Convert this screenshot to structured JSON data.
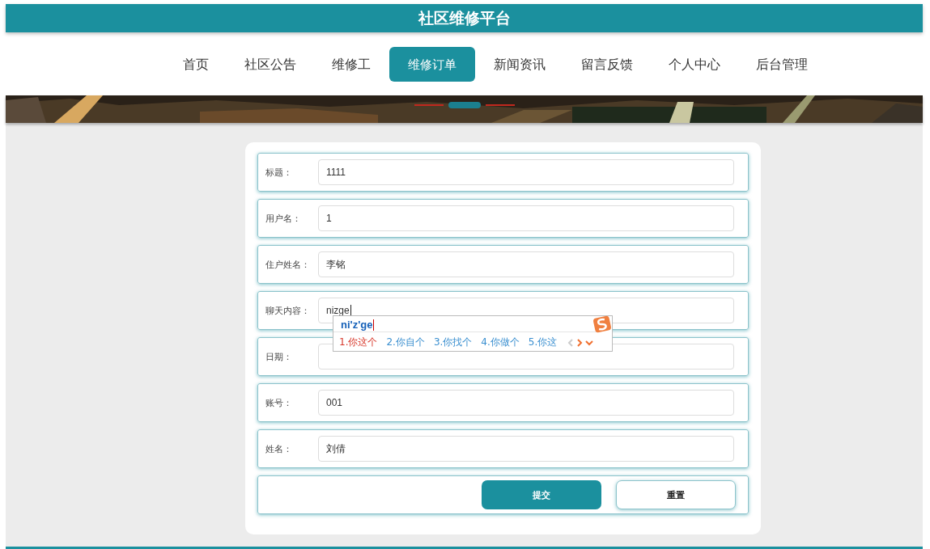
{
  "header": {
    "title": "社区维修平台"
  },
  "nav": [
    {
      "label": "首页",
      "selected": false
    },
    {
      "label": "社区公告",
      "selected": false
    },
    {
      "label": "维修工",
      "selected": false
    },
    {
      "label": "维修订单",
      "selected": true
    },
    {
      "label": "新闻资讯",
      "selected": false
    },
    {
      "label": "留言反馈",
      "selected": false
    },
    {
      "label": "个人中心",
      "selected": false
    },
    {
      "label": "后台管理",
      "selected": false
    }
  ],
  "banner": {
    "kind": "picture",
    "indicators": [
      {
        "selected": false
      },
      {
        "selected": true
      },
      {
        "selected": false
      }
    ]
  },
  "form": {
    "fields": [
      {
        "label": "标题：",
        "value": "1111"
      },
      {
        "label": "用户名：",
        "value": "1"
      },
      {
        "label": "住户姓名：",
        "value": "李铭"
      },
      {
        "label": "聊天内容：",
        "value": "nizge",
        "focused": true
      },
      {
        "label": "日期："
      },
      {
        "label": "账号：",
        "value": "001"
      },
      {
        "label": "姓名：",
        "value": "刘倩"
      }
    ],
    "buttons": [
      {
        "label": "提交",
        "kind": "primary"
      },
      {
        "label": "重置",
        "kind": "secondary"
      }
    ]
  },
  "ime": {
    "composition": "ni'z'ge",
    "candidates": [
      {
        "text": "1.你这个",
        "selected": true
      },
      {
        "text": "2.你自个",
        "selected": false
      },
      {
        "text": "3.你找个",
        "selected": false
      },
      {
        "text": "4.你做个",
        "selected": false
      },
      {
        "text": "5.你这",
        "selected": false
      }
    ]
  }
}
